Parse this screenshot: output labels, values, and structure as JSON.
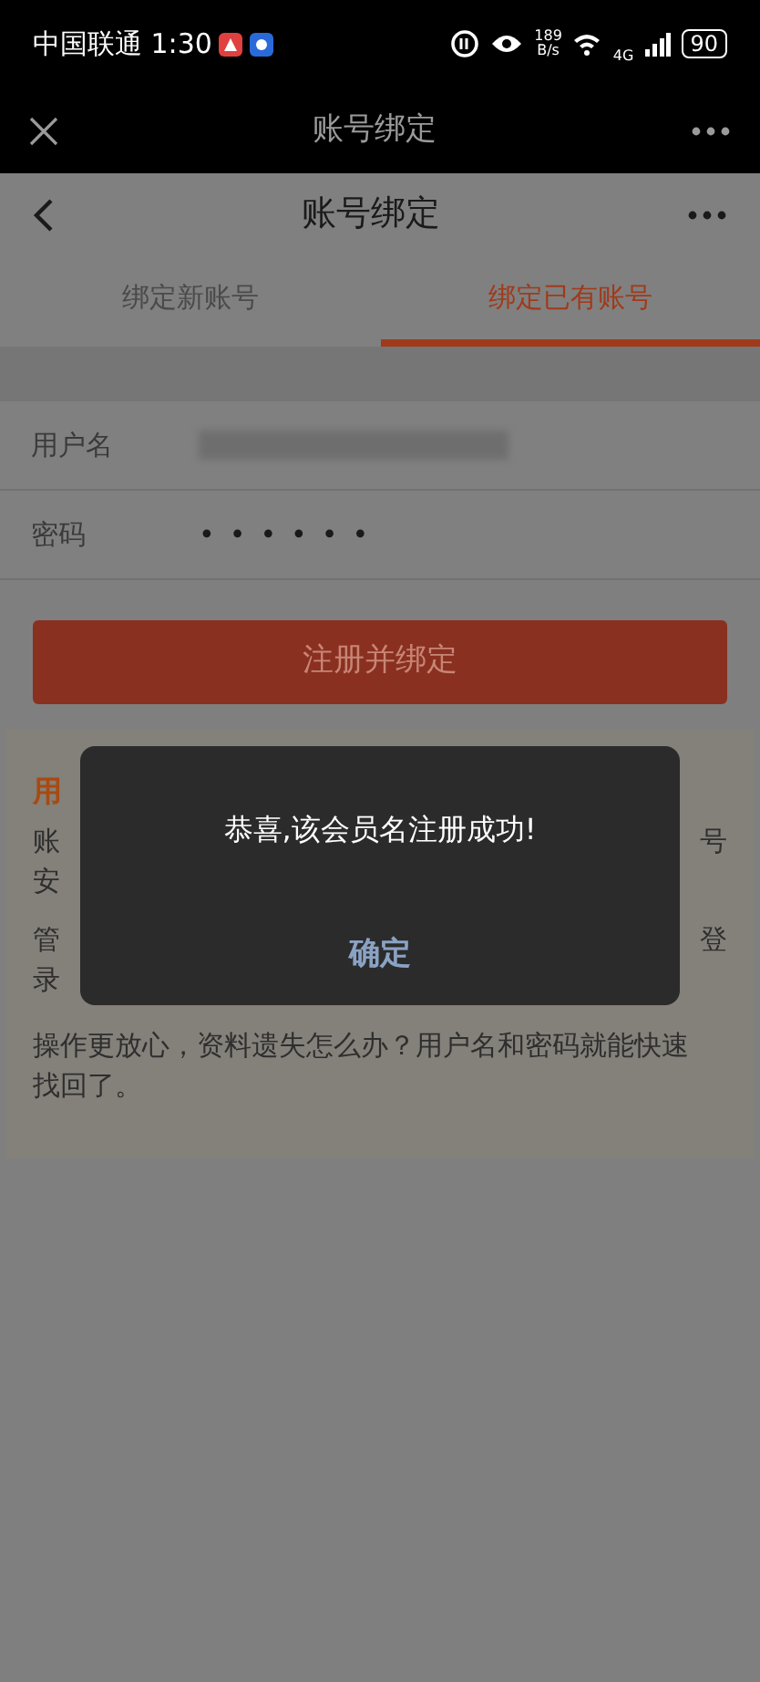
{
  "status_bar": {
    "carrier_time": "中国联通 1:30",
    "speed": "189",
    "speed_unit": "B/s",
    "network": "4G",
    "battery": "90"
  },
  "browser_bar": {
    "title": "账号绑定"
  },
  "nav_bar": {
    "title": "账号绑定"
  },
  "tabs": [
    {
      "label": "绑定新账号",
      "selected": false
    },
    {
      "label": "绑定已有账号",
      "selected": true
    }
  ],
  "form": {
    "fields": [
      {
        "label": "用户名",
        "kind": "redacted"
      },
      {
        "label": "密码",
        "kind": "password",
        "value": "••••••"
      }
    ],
    "submit": "注册并绑定"
  },
  "info_card": {
    "heading": "用",
    "lines": [
      {
        "left": "账",
        "right": "号"
      },
      {
        "left": "安"
      },
      {
        "left": "管",
        "right": "登"
      },
      {
        "left": "录"
      }
    ],
    "paragraph": "操作更放心，资料遗失怎么办？用户名和密码就能快速找回了。"
  },
  "dialog": {
    "message": "恭喜,该会员名注册成功!",
    "button": "确定"
  }
}
